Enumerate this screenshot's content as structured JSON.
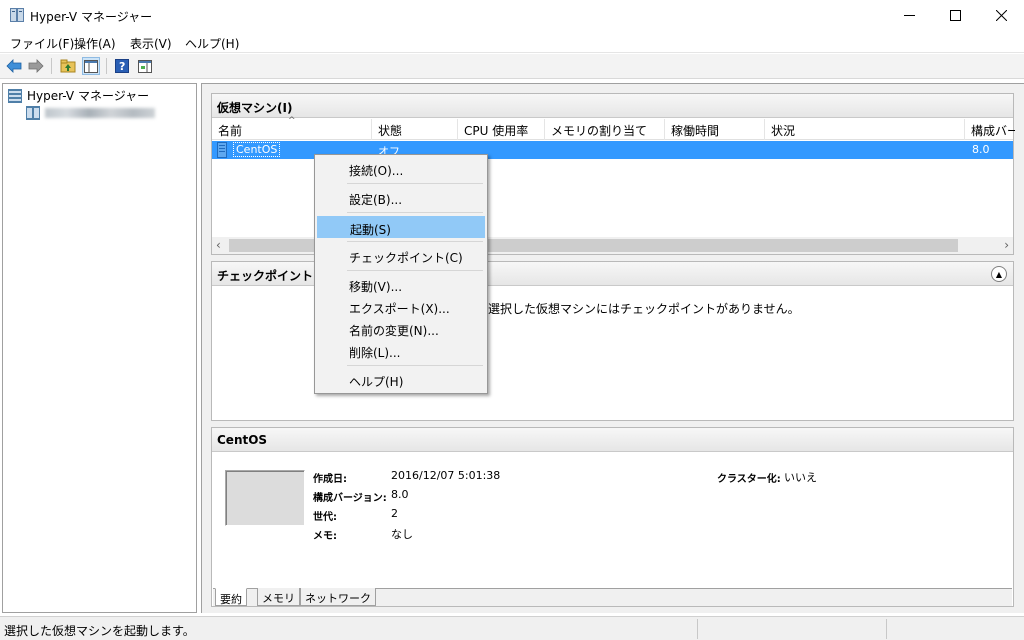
{
  "window": {
    "title": "Hyper-V マネージャー"
  },
  "menu": [
    "ファイル(F)",
    "操作(A)",
    "表示(V)",
    "ヘルプ(H)"
  ],
  "toolbar": {
    "icons": [
      "back-arrow-icon",
      "forward-arrow-icon",
      "up-folder-icon",
      "show-hide-tree-icon",
      "help-icon",
      "show-action-pane-icon"
    ]
  },
  "tree": {
    "root_label": "Hyper-V マネージャー",
    "host_label_blurred": true
  },
  "vm_panel": {
    "header": "仮想マシン(I)",
    "columns": [
      "名前",
      "状態",
      "CPU 使用率",
      "メモリの割り当て",
      "稼働時間",
      "状況",
      "構成バー"
    ],
    "rows": [
      {
        "name": "CentOS",
        "state": "オフ",
        "cpu": "",
        "memory": "",
        "uptime": "",
        "status": "",
        "config_version": "8.0"
      }
    ]
  },
  "checkpoint_panel": {
    "header": "チェックポイント(C)",
    "empty_message": "選択した仮想マシンにはチェックポイントがありません。"
  },
  "detail_panel": {
    "header": "CentOS",
    "fields": {
      "created_label": "作成日:",
      "created_value": "2016/12/07 5:01:38",
      "config_version_label": "構成バージョン:",
      "config_version_value": "8.0",
      "generation_label": "世代:",
      "generation_value": "2",
      "notes_label": "メモ:",
      "notes_value": "なし",
      "cluster_label": "クラスター化:",
      "cluster_value": "いいえ"
    },
    "tabs": [
      "要約",
      "メモリ",
      "ネットワーク"
    ],
    "active_tab": "要約"
  },
  "context_menu": {
    "items": [
      {
        "label": "接続(O)..."
      },
      {
        "label": "設定(B)..."
      },
      {
        "label": "起動(S)",
        "highlighted": true
      },
      {
        "label": "チェックポイント(C)"
      },
      {
        "label": "移動(V)..."
      },
      {
        "label": "エクスポート(X)..."
      },
      {
        "label": "名前の変更(N)..."
      },
      {
        "label": "削除(L)..."
      },
      {
        "label": "ヘルプ(H)"
      }
    ]
  },
  "statusbar": {
    "text": "選択した仮想マシンを起動します。"
  },
  "colors": {
    "selection": "#3399ff",
    "menu_highlight": "#91c9f7",
    "panel_header": "#e6e6e6"
  }
}
